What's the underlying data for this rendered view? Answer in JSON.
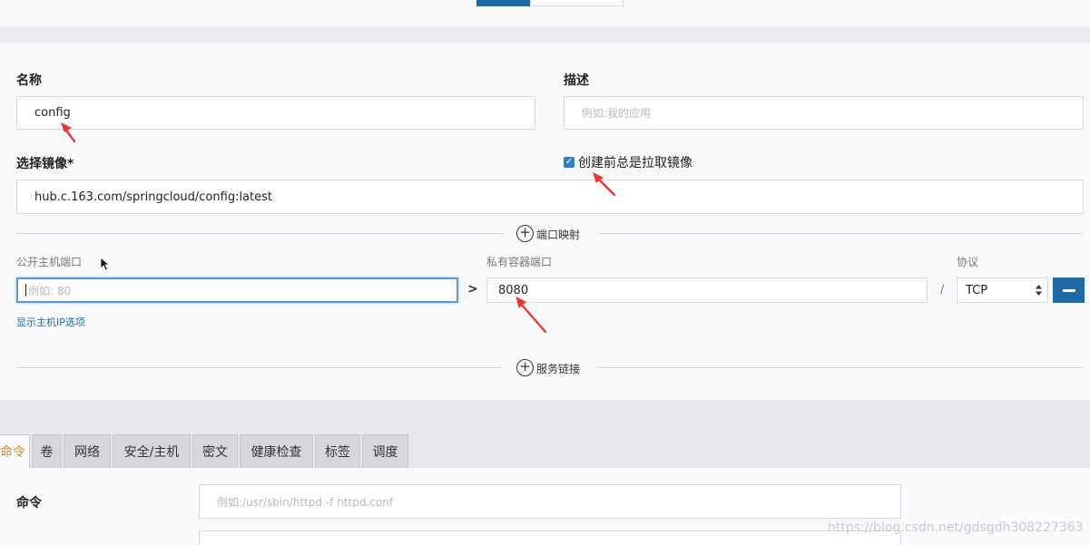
{
  "form": {
    "name_label": "名称",
    "name_value": "config",
    "desc_label": "描述",
    "desc_placeholder": "例如:我的应用",
    "image_label": "选择镜像*",
    "image_value": "hub.c.163.com/springcloud/config:latest",
    "always_pull_label": "创建前总是拉取镜像",
    "always_pull_checked": true
  },
  "port_mapping": {
    "section_label": "端口映射",
    "public_port_label": "公开主机端口",
    "public_port_placeholder": "例如: 80",
    "arrow_glyph": ">",
    "private_port_label": "私有容器端口",
    "private_port_value": "8080",
    "slash": "/",
    "protocol_label": "协议",
    "protocol_value": "TCP",
    "show_host_ip_label": "显示主机IP选项"
  },
  "service_link": {
    "section_label": "服务链接"
  },
  "tabs": [
    {
      "label": "命令",
      "active": true
    },
    {
      "label": "卷"
    },
    {
      "label": "网络"
    },
    {
      "label": "安全/主机"
    },
    {
      "label": "密文"
    },
    {
      "label": "健康检查"
    },
    {
      "label": "标签"
    },
    {
      "label": "调度"
    }
  ],
  "command": {
    "label": "命令",
    "placeholder": "例如:/usr/sbin/httpd -f httpd.conf"
  },
  "watermark": "https://blog.csdn.net/gdsgdh308227363",
  "colors": {
    "primary": "#1f6aa5",
    "annotation_arrow": "#e8382f",
    "active_tab_text": "#c98a2b"
  }
}
